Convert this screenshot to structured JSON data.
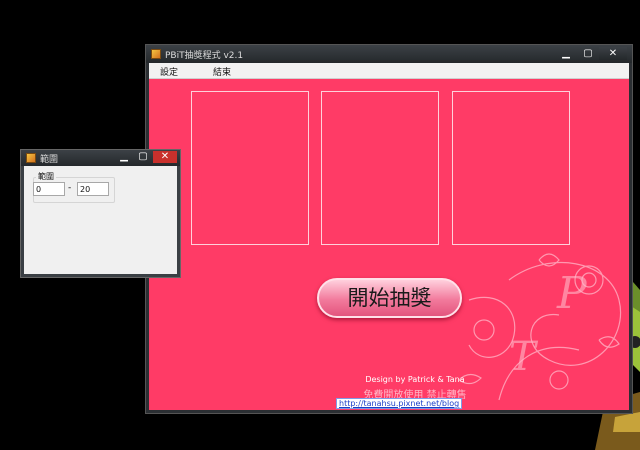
{
  "main_window": {
    "title": "PBiT抽獎程式 v2.1",
    "menu": {
      "settings": "設定",
      "exit": "結束"
    },
    "controls": {
      "minimize": "▁",
      "maximize": "▢",
      "close": "✕"
    },
    "start_button": "開始抽獎",
    "footer": {
      "credit": "Design by Patrick & Tana",
      "notice": "免費開放使用  禁止轉售",
      "link": "http://tanahsu.pixnet.net/blog"
    }
  },
  "range_dialog": {
    "title": "範圍",
    "group_label": "範圍",
    "min_value": "0",
    "separator": "-",
    "max_value": "20",
    "controls": {
      "minimize": "▁",
      "maximize": "▢",
      "close": "✕"
    }
  },
  "colors": {
    "accent": "#ff3b66",
    "close_button": "#c9302c"
  }
}
